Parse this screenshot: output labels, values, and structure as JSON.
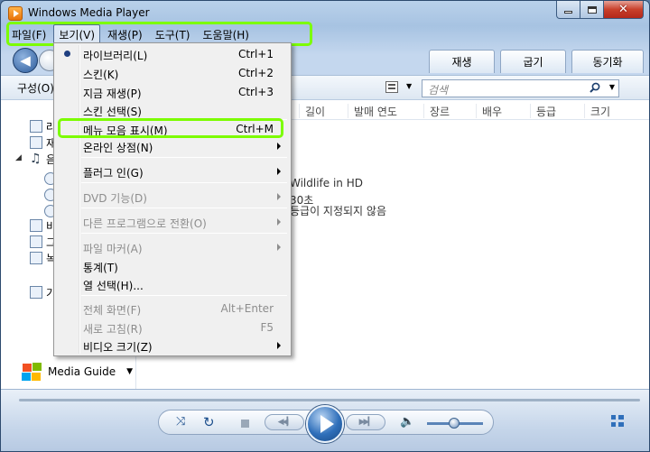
{
  "window": {
    "title": "Windows Media Player"
  },
  "menubar": [
    "파일(F)",
    "보기(V)",
    "재생(P)",
    "도구(T)",
    "도움말(H)"
  ],
  "tabs": [
    "재생",
    "굽기",
    "동기화"
  ],
  "toolbar": {
    "organize": "구성(O)",
    "search_placeholder": "검색"
  },
  "columns": [
    "길이",
    "발매 연도",
    "장르",
    "배우",
    "등급",
    "크기"
  ],
  "sidebar": {
    "items": [
      {
        "label": "라"
      },
      {
        "label": "재"
      },
      {
        "label": "음"
      },
      {
        "label": "비"
      },
      {
        "label": "그"
      },
      {
        "label": "녹"
      },
      {
        "label": "기"
      }
    ],
    "media_guide": "Media Guide"
  },
  "details": {
    "title": "Wildlife in HD",
    "length": "30초",
    "rating": "등급이 지정되지 않음"
  },
  "view_menu": {
    "items": [
      {
        "label": "라이브러리(L)",
        "shortcut": "Ctrl+1",
        "checked": true
      },
      {
        "label": "스킨(K)",
        "shortcut": "Ctrl+2"
      },
      {
        "label": "지금 재생(P)",
        "shortcut": "Ctrl+3"
      },
      {
        "label": "스킨 선택(S)",
        "shortcut": ""
      },
      {
        "label": "메뉴 모음 표시(M)",
        "shortcut": "Ctrl+M"
      },
      {
        "label": "온라인 상점(N)",
        "shortcut": "",
        "submenu": true
      },
      {
        "label": "플러그 인(G)",
        "shortcut": "",
        "submenu": true
      },
      {
        "label": "DVD 기능(D)",
        "shortcut": "",
        "submenu": true,
        "disabled": true
      },
      {
        "label": "다른 프로그램으로 전환(O)",
        "shortcut": "",
        "submenu": true,
        "disabled": true
      },
      {
        "label": "파일 마커(A)",
        "shortcut": "",
        "submenu": true,
        "disabled": true
      },
      {
        "label": "통계(T)",
        "shortcut": ""
      },
      {
        "label": "열 선택(H)...",
        "shortcut": ""
      },
      {
        "label": "전체 화면(F)",
        "shortcut": "Alt+Enter",
        "disabled": true
      },
      {
        "label": "새로 고침(R)",
        "shortcut": "F5",
        "disabled": true
      },
      {
        "label": "비디오 크기(Z)",
        "shortcut": "",
        "submenu": true
      }
    ]
  },
  "colors": {
    "highlight": "#7cfc00",
    "accent": "#2f6fba"
  },
  "icons": {
    "back": "back-arrow-icon",
    "forward": "forward-arrow-icon",
    "search": "search-icon",
    "shuffle": "shuffle-icon",
    "repeat": "repeat-icon",
    "stop": "stop-icon",
    "previous": "previous-icon",
    "play": "play-icon",
    "next": "next-icon",
    "volume": "speaker-icon",
    "switch_view": "switch-to-now-playing-icon"
  }
}
